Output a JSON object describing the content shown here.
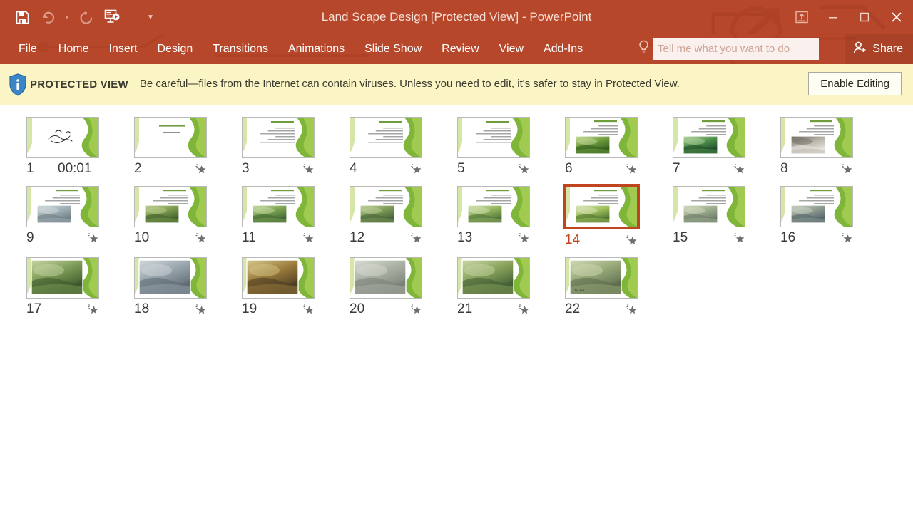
{
  "window": {
    "title": "Land Scape Design [Protected View] - PowerPoint",
    "quick_access": [
      {
        "name": "save-icon",
        "label": "Save",
        "enabled": true
      },
      {
        "name": "undo-icon",
        "label": "Undo",
        "enabled": false
      },
      {
        "name": "redo-icon",
        "label": "Redo",
        "enabled": false
      },
      {
        "name": "start-presentation-icon",
        "label": "Start From Beginning",
        "enabled": true
      },
      {
        "name": "customize-quick-access-toolbar-icon",
        "label": "Customize Quick Access Toolbar",
        "enabled": true
      }
    ],
    "controls": [
      {
        "name": "ribbon-display-options-icon",
        "label": "Ribbon Display Options"
      },
      {
        "name": "minimize-icon",
        "label": "Minimize"
      },
      {
        "name": "restore-icon",
        "label": "Restore Down"
      },
      {
        "name": "close-icon",
        "label": "Close"
      }
    ]
  },
  "ribbon": {
    "tabs": [
      {
        "label": "File"
      },
      {
        "label": "Home"
      },
      {
        "label": "Insert"
      },
      {
        "label": "Design"
      },
      {
        "label": "Transitions"
      },
      {
        "label": "Animations"
      },
      {
        "label": "Slide Show"
      },
      {
        "label": "Review"
      },
      {
        "label": "View"
      },
      {
        "label": "Add-Ins"
      }
    ],
    "tellme": {
      "placeholder": "Tell me what you want to do",
      "value": "",
      "icon": "lightbulb-icon"
    },
    "share_label": "Share",
    "share_icon": "share-person-icon"
  },
  "protected_view": {
    "icon": "info-shield-icon",
    "label": "PROTECTED VIEW",
    "message": "Be careful—files from the Internet can contain viruses. Unless you need to edit, it's safer to stay in Protected View.",
    "enable_button": "Enable Editing"
  },
  "slide_sorter": {
    "selected_slide": 14,
    "star_icon": "transition-star-icon",
    "slides": [
      {
        "num": "1",
        "timing": "00:01",
        "star": false,
        "kind": "title-calligraphy"
      },
      {
        "num": "2",
        "timing": "",
        "star": true,
        "kind": "title-text"
      },
      {
        "num": "3",
        "timing": "",
        "star": true,
        "kind": "bullets"
      },
      {
        "num": "4",
        "timing": "",
        "star": true,
        "kind": "bullets"
      },
      {
        "num": "5",
        "timing": "",
        "star": true,
        "kind": "bullets"
      },
      {
        "num": "6",
        "timing": "",
        "star": true,
        "kind": "photo-bamboo"
      },
      {
        "num": "7",
        "timing": "",
        "star": true,
        "kind": "photo-green-path"
      },
      {
        "num": "8",
        "timing": "",
        "star": true,
        "kind": "photo-white-sculpture"
      },
      {
        "num": "9",
        "timing": "",
        "star": true,
        "kind": "photo-plaza"
      },
      {
        "num": "10",
        "timing": "",
        "star": true,
        "kind": "photo-aerial-park"
      },
      {
        "num": "11",
        "timing": "",
        "star": true,
        "kind": "photo-lake-park"
      },
      {
        "num": "12",
        "timing": "",
        "star": true,
        "kind": "photo-aerial-town"
      },
      {
        "num": "13",
        "timing": "",
        "star": true,
        "kind": "photo-meadow"
      },
      {
        "num": "14",
        "timing": "",
        "star": true,
        "kind": "photo-road-curve"
      },
      {
        "num": "15",
        "timing": "",
        "star": true,
        "kind": "photo-building-garden"
      },
      {
        "num": "16",
        "timing": "",
        "star": true,
        "kind": "photo-valley"
      },
      {
        "num": "17",
        "timing": "",
        "star": true,
        "kind": "full-photo-lawn"
      },
      {
        "num": "18",
        "timing": "",
        "star": true,
        "kind": "full-photo-steps"
      },
      {
        "num": "19",
        "timing": "",
        "star": true,
        "kind": "full-photo-autumn"
      },
      {
        "num": "20",
        "timing": "",
        "star": true,
        "kind": "full-photo-pavement"
      },
      {
        "num": "21",
        "timing": "",
        "star": true,
        "kind": "full-photo-aerial-roofs"
      },
      {
        "num": "22",
        "timing": "",
        "star": true,
        "kind": "full-photo-end",
        "overlay_text": "The End"
      }
    ]
  },
  "colors": {
    "brand": "#B7472A",
    "selection": "#C0451F",
    "banner_bg": "#FBF4C4",
    "slide_accent_green": "#8DC63F"
  }
}
